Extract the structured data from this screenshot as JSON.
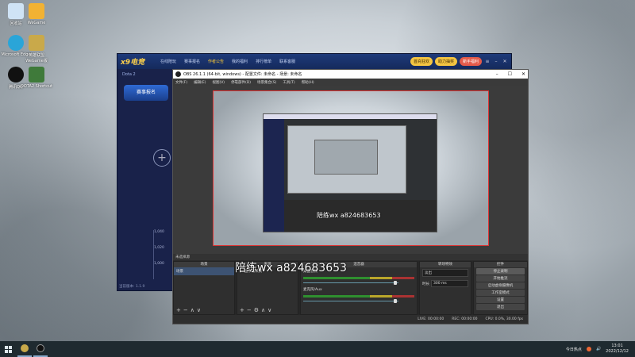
{
  "desktop": {
    "icons": [
      {
        "label": "回收站",
        "color": "#cfe3f5"
      },
      {
        "label": "WeGame",
        "color": "#f2b233"
      },
      {
        "label": "Microsoft Edge",
        "color": "#2aa5d8"
      },
      {
        "label": "英雄联盟WeGame版",
        "color": "#c9a94a"
      },
      {
        "label": "腾讯QQ",
        "color": "#111111"
      },
      {
        "label": "DOTA2 Shortcut",
        "color": "#3f7a3a"
      }
    ]
  },
  "game_window": {
    "logo": "x9电竞",
    "nav": [
      "在线陪玩",
      "赛事报名",
      "作者公告",
      "我的福利",
      "排行榜单",
      "联系客服"
    ],
    "active_nav": "作者公告",
    "buttons": [
      "首充狂欢",
      "助力抽奖",
      "新手福利"
    ],
    "side_tab": "Dota 2",
    "side_badge": "赛事报名",
    "plus": "+",
    "chart_ticks": [
      "1,040",
      "1,020",
      "1,000",
      "980"
    ],
    "footer": "当前版本: 1.1.9"
  },
  "obs": {
    "title": "OBS 26.1.1 (64-bit, windows) - 配置文件: 未命名 - 场景: 未命名",
    "menu": [
      "文件(F)",
      "编辑(E)",
      "视图(V)",
      "停靠部件(D)",
      "场景集合(S)",
      "工具(T)",
      "帮助(H)"
    ],
    "dockbar_label": "未选择源",
    "docks": {
      "scenes": {
        "title": "场景",
        "items": [
          "场景"
        ]
      },
      "sources": {
        "title": "来源",
        "items": [
          "显示器采集"
        ]
      },
      "mixer": {
        "title": "混音器",
        "channels": [
          {
            "name": "桌面音频",
            "db": "0.0 dB"
          },
          {
            "name": "麦克风/Aux",
            "db": "0.0 dB"
          }
        ]
      },
      "transitions": {
        "title": "转场特效",
        "type": "淡出",
        "duration_label": "时长",
        "duration": "300 ms"
      },
      "controls": {
        "title": "控件",
        "buttons": [
          "停止录制",
          "开始推流",
          "启动虚拟摄像机",
          "工作室模式",
          "设置",
          "退出"
        ]
      }
    },
    "status": [
      "LIVE: 00:00:00",
      "REC: 00:00:00",
      "CPU: 0.0%, 30.00 fps"
    ],
    "nested_watermark": "陪练wx a824683653"
  },
  "overlay_watermark": "陪练wx a824683653",
  "taskbar": {
    "weather": "今日热点",
    "time": "13:01",
    "date": "2022/12/12"
  }
}
